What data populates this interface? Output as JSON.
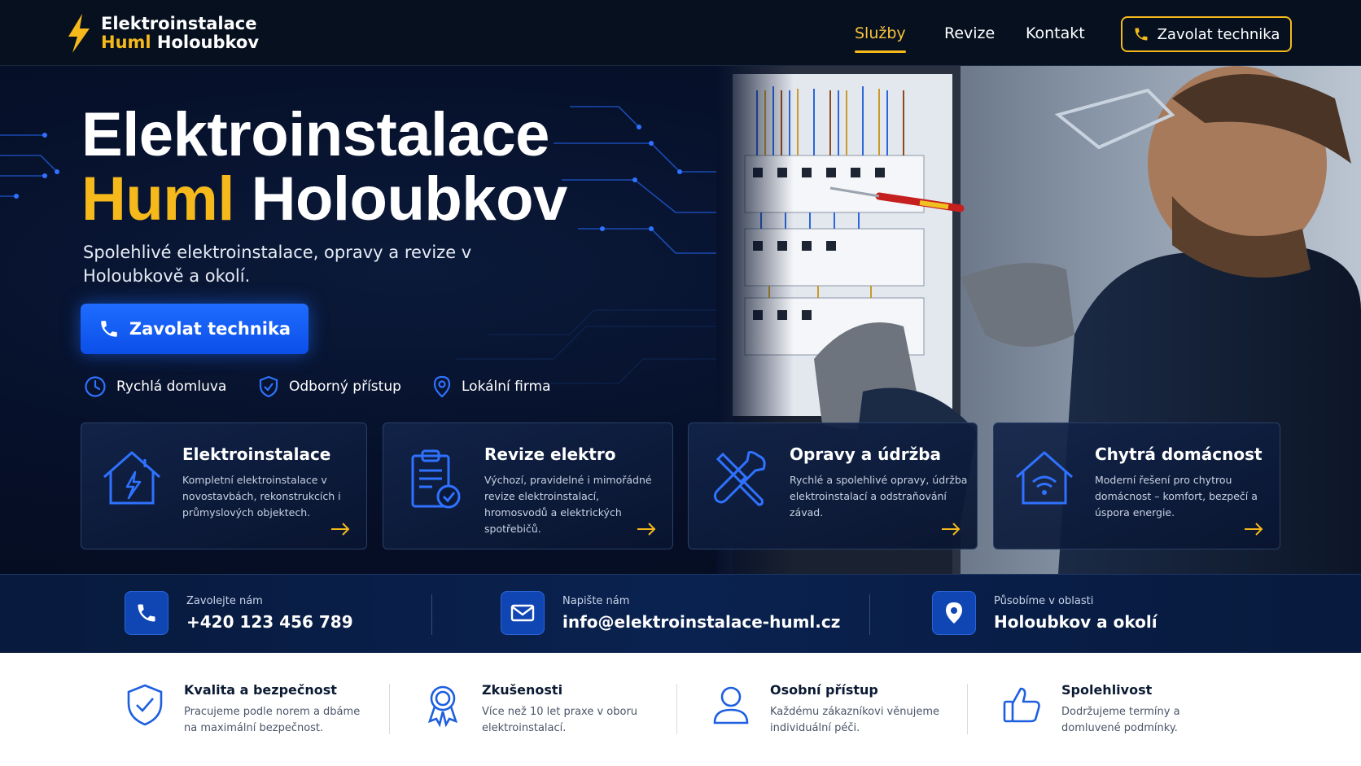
{
  "brand": {
    "line1": "Elektroinstalace",
    "line2_accent": "Huml",
    "line2_rest": " Holoubkov",
    "accent_color": "#f5b91c",
    "logo_icon": "lightning-bolt-icon"
  },
  "nav": {
    "items": [
      {
        "label": "Služby",
        "active": true
      },
      {
        "label": "Revize",
        "active": false
      },
      {
        "label": "Kontakt",
        "active": false
      }
    ],
    "call_button": "Zavolat technika"
  },
  "hero": {
    "title_line1": "Elektroinstalace",
    "title_accent": "Huml",
    "title_rest": " Holoubkov",
    "subtitle": "Spolehlivé elektroinstalace, opravy a revize v Holoubkově a okolí.",
    "cta": "Zavolat technika",
    "cta_color": "#1560ff",
    "features": [
      {
        "icon": "clock-icon",
        "label": "Rychlá domluva"
      },
      {
        "icon": "shield-check-icon",
        "label": "Odborný přístup"
      },
      {
        "icon": "location-pin-icon",
        "label": "Lokální firma"
      }
    ]
  },
  "services": [
    {
      "icon": "house-bolt-icon",
      "title": "Elektroinstalace",
      "desc": "Kompletní elektroinstalace v novostavbách, rekonstrukcích i průmyslových objektech."
    },
    {
      "icon": "clipboard-check-icon",
      "title": "Revize elektro",
      "desc": "Výchozí, pravidelné i mimořádné revize elektroinstalací, hromosvodů a elektrických spotřebičů."
    },
    {
      "icon": "tools-icon",
      "title": "Opravy a údržba",
      "desc": "Rychlé a spolehlivé opravy, údržba elektroinstalací a odstraňování závad."
    },
    {
      "icon": "smart-home-icon",
      "title": "Chytrá domácnost",
      "desc": "Moderní řešení pro chytrou domácnost – komfort, bezpečí a úspora energie."
    }
  ],
  "contacts": [
    {
      "icon": "phone-icon",
      "label": "Zavolejte nám",
      "value": "+420 123 456 789"
    },
    {
      "icon": "mail-icon",
      "label": "Napište nám",
      "value": "info@elektroinstalace-huml.cz"
    },
    {
      "icon": "location-pin-icon",
      "label": "Působíme v oblasti",
      "value": "Holoubkov a okolí"
    }
  ],
  "benefits": [
    {
      "icon": "shield-check-icon",
      "title": "Kvalita a bezpečnost",
      "desc": "Pracujeme podle norem a dbáme na maximální bezpečnost."
    },
    {
      "icon": "award-icon",
      "title": "Zkušenosti",
      "desc": "Více než 10 let praxe v oboru elektroinstalací."
    },
    {
      "icon": "user-icon",
      "title": "Osobní přístup",
      "desc": "Každému zákazníkovi věnujeme individuální péči."
    },
    {
      "icon": "thumbs-up-icon",
      "title": "Spolehlivost",
      "desc": "Dodržujeme termíny a domluvené podmínky."
    }
  ]
}
